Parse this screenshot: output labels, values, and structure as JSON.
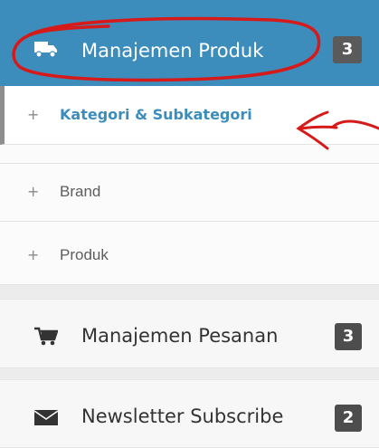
{
  "menu": {
    "product": {
      "label": "Manajemen Produk",
      "badge": "3",
      "icon": "truck-icon",
      "accent": "#3c8dbc"
    },
    "subitems": [
      {
        "label": "Kategori & Subkategori",
        "prefix": "+",
        "active": true
      },
      {
        "label": "Brand",
        "prefix": "+",
        "active": false
      },
      {
        "label": "Produk",
        "prefix": "+",
        "active": false
      }
    ],
    "orders": {
      "label": "Manajemen Pesanan",
      "badge": "3",
      "icon": "shopping-cart-icon"
    },
    "newsletter": {
      "label": "Newsletter Subscribe",
      "badge": "2",
      "icon": "envelope-icon"
    }
  },
  "annotation_color": "#d61a1a"
}
